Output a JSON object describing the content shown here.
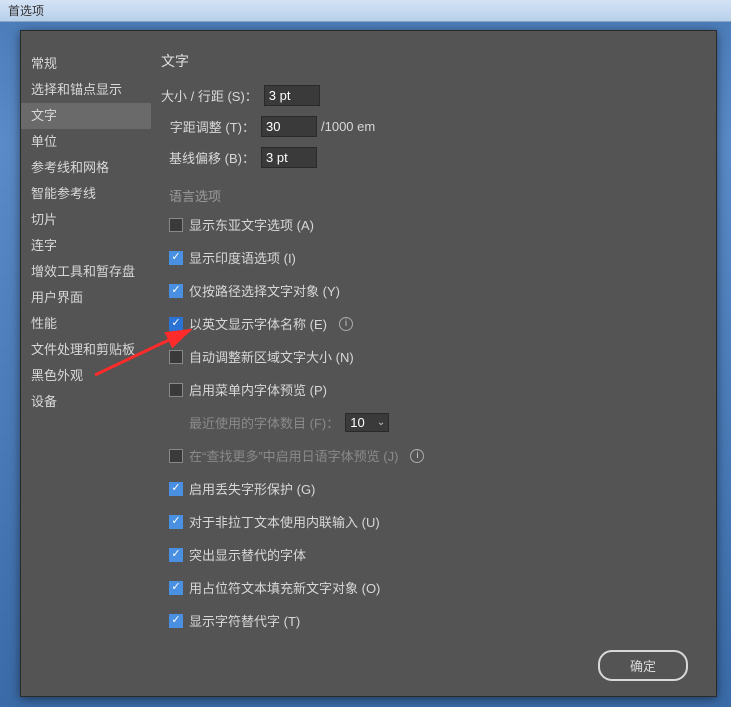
{
  "window_title": "首选项",
  "sidebar": {
    "items": [
      {
        "label": "常规"
      },
      {
        "label": "选择和锚点显示"
      },
      {
        "label": "文字",
        "selected": true
      },
      {
        "label": "单位"
      },
      {
        "label": "参考线和网格"
      },
      {
        "label": "智能参考线"
      },
      {
        "label": "切片"
      },
      {
        "label": "连字"
      },
      {
        "label": "增效工具和暂存盘"
      },
      {
        "label": "用户界面"
      },
      {
        "label": "性能"
      },
      {
        "label": "文件处理和剪贴板"
      },
      {
        "label": "黑色外观"
      },
      {
        "label": "设备"
      }
    ]
  },
  "panel": {
    "title": "文字",
    "fields": {
      "size_leading_label": "大小 / 行距 (S)：",
      "size_leading_value": "3 pt",
      "tracking_label": "字距调整 (T)：",
      "tracking_value": "30",
      "tracking_unit": "/1000 em",
      "baseline_label": "基线偏移 (B)：",
      "baseline_value": "3 pt"
    },
    "lang_section_label": "语言选项",
    "checkboxes": {
      "east_asian": {
        "label": "显示东亚文字选项 (A)",
        "checked": false
      },
      "indic": {
        "label": "显示印度语选项 (I)",
        "checked": true
      },
      "path_only": {
        "label": "仅按路径选择文字对象 (Y)",
        "checked": true
      },
      "english_fonts": {
        "label": "以英文显示字体名称 (E)",
        "checked": true,
        "info": true,
        "highlight": true
      },
      "auto_size_area": {
        "label": "自动调整新区域文字大小 (N)",
        "checked": false
      },
      "font_preview_menu": {
        "label": "启用菜单内字体预览 (P)",
        "checked": false
      },
      "recent_fonts_label": "最近使用的字体数目 (F)：",
      "recent_fonts_value": "10",
      "jp_preview": {
        "label": "在“查找更多”中启用日语字体预览 (J)",
        "checked": false,
        "info": true,
        "disabled": true
      },
      "missing_glyph": {
        "label": "启用丢失字形保护 (G)",
        "checked": true
      },
      "inline_input": {
        "label": "对于非拉丁文本使用内联输入 (U)",
        "checked": true
      },
      "highlight_alt": {
        "label": "突出显示替代的字体",
        "checked": true
      },
      "placeholder_text": {
        "label": "用占位符文本填充新文字对象 (O)",
        "checked": true
      },
      "show_alt_glyph": {
        "label": "显示字符替代字 (T)",
        "checked": true
      }
    }
  },
  "buttons": {
    "ok": "确定"
  }
}
